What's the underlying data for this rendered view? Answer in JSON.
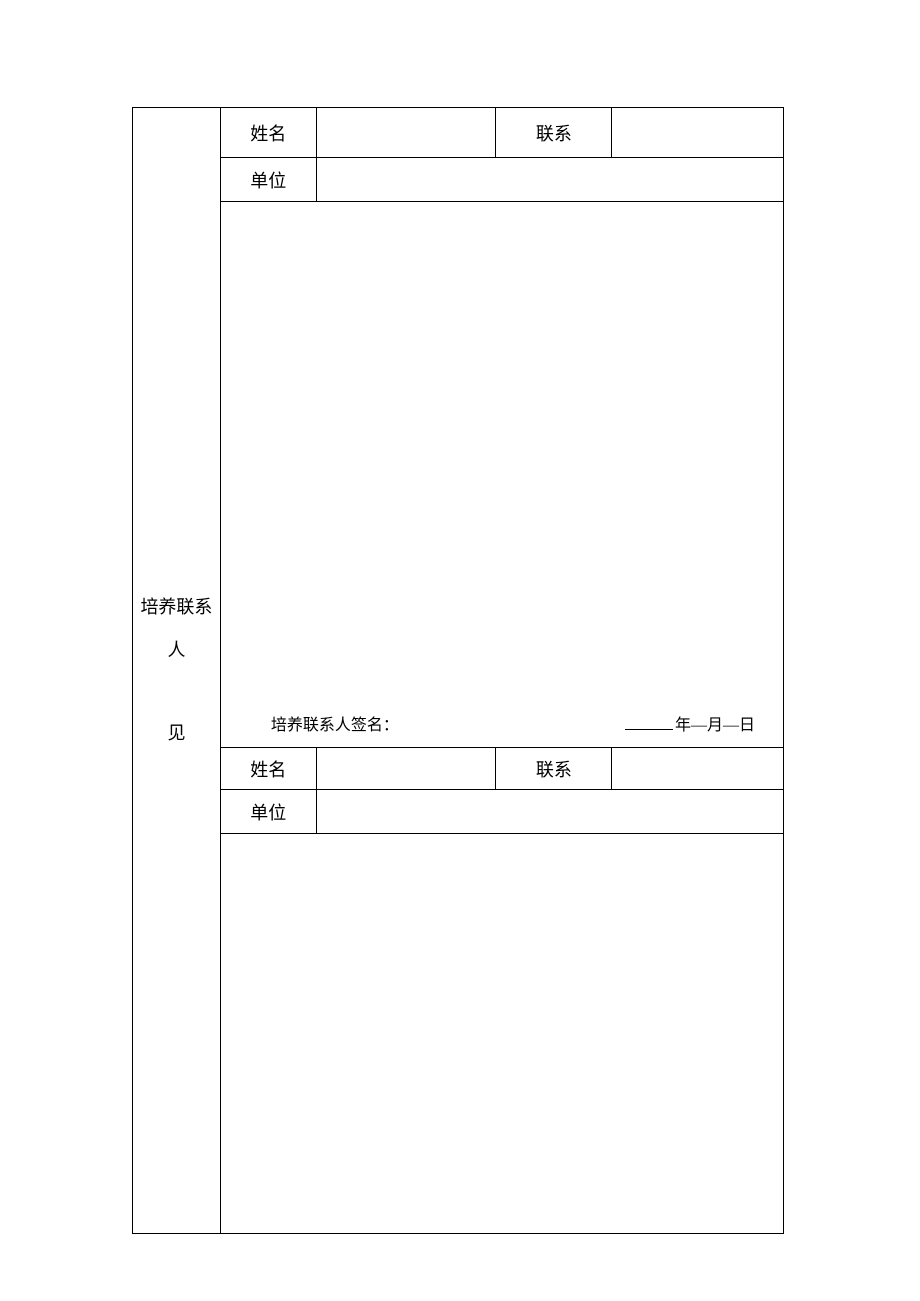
{
  "leftHeader": {
    "line1": "培养联系",
    "line2": "人",
    "line3": "见"
  },
  "section1": {
    "nameLabel": "姓名",
    "nameValue": "",
    "contactLabel": "联系",
    "contactValue": "",
    "unitLabel": "单位",
    "unitValue": "",
    "signatureLabel": "培养联系人签名：",
    "dateYear": "年",
    "dateMonthSep": "—",
    "dateMonth": "月",
    "dateDaySep": "—",
    "dateDay": "日"
  },
  "section2": {
    "nameLabel": "姓名",
    "nameValue": "",
    "contactLabel": "联系",
    "contactValue": "",
    "unitLabel": "单位",
    "unitValue": ""
  }
}
